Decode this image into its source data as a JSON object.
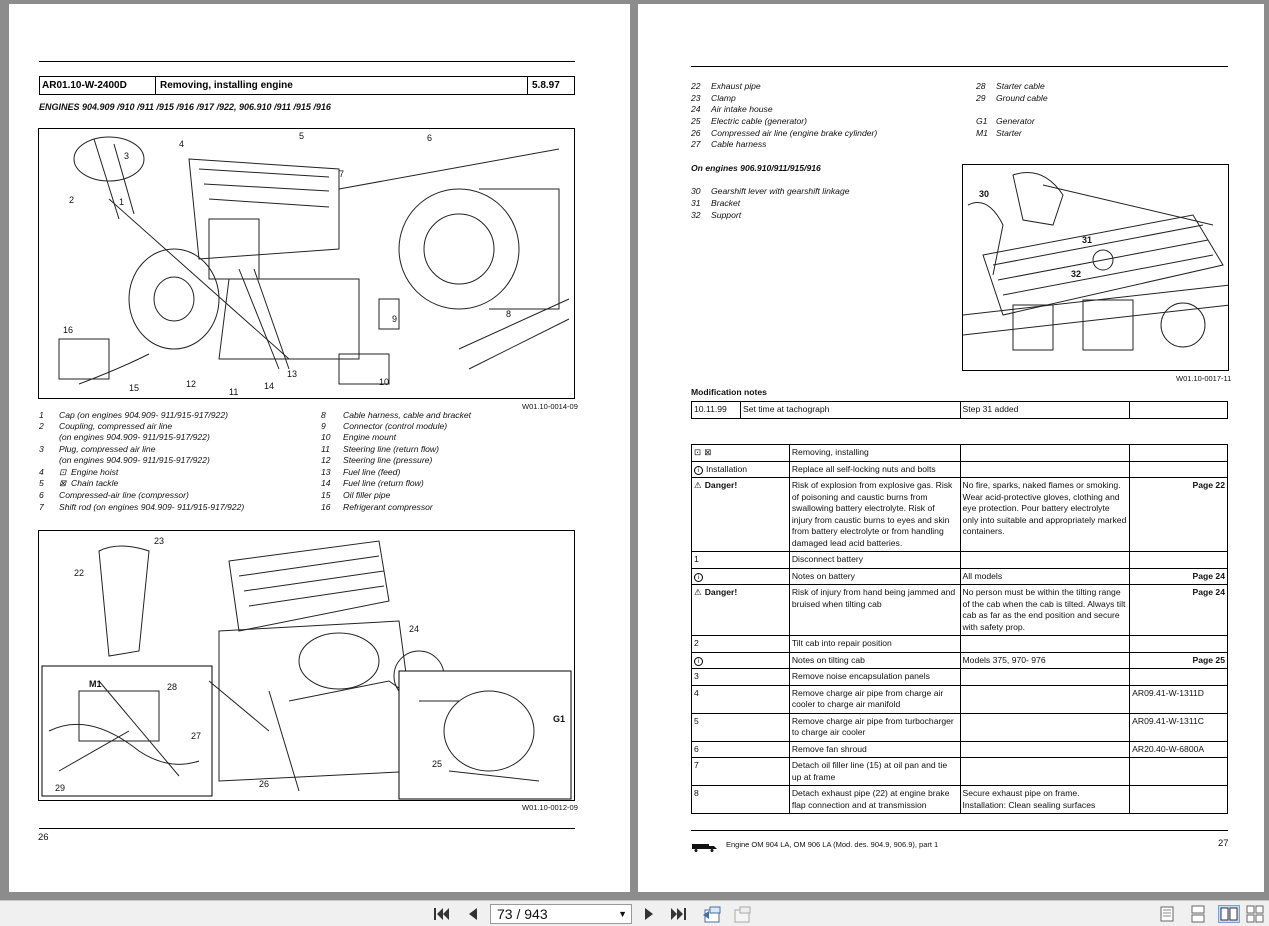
{
  "left_page": {
    "header": {
      "code": "AR01.10-W-2400D",
      "title": "Removing, installing engine",
      "date": "5.8.97"
    },
    "engines_line": "ENGINES   904.909 /910 /911 /915 /916 /917 /922, 906.910 /911 /915 /916",
    "fig1": {
      "caption": "W01.10-0014-09",
      "labels": [
        "1",
        "2",
        "3",
        "4",
        "5",
        "6",
        "7",
        "8",
        "9",
        "10",
        "11",
        "12",
        "13",
        "14",
        "15",
        "16"
      ]
    },
    "legend_left": [
      {
        "n": "1",
        "text": "Cap (on engines 904.909- 911/915-917/922)"
      },
      {
        "n": "2",
        "text": "Coupling, compressed air line"
      },
      {
        "n": "",
        "text": "(on engines 904.909- 911/915-917/922)"
      },
      {
        "n": "3",
        "text": "Plug, compressed air line"
      },
      {
        "n": "",
        "text": "(on engines 904.909- 911/915-917/922)"
      },
      {
        "n": "4",
        "text": "Engine hoist"
      },
      {
        "n": "5",
        "text": "Chain tackle"
      },
      {
        "n": "6",
        "text": "Compressed-air line (compressor)"
      },
      {
        "n": "7",
        "text": "Shift rod (on engines 904.909- 911/915-917/922)"
      }
    ],
    "legend_right": [
      {
        "n": "8",
        "text": "Cable harness, cable and bracket"
      },
      {
        "n": "9",
        "text": "Connector (control module)"
      },
      {
        "n": "10",
        "text": "Engine mount"
      },
      {
        "n": "11",
        "text": "Steering line (return flow)"
      },
      {
        "n": "12",
        "text": "Steering line (pressure)"
      },
      {
        "n": "13",
        "text": "Fuel line (feed)"
      },
      {
        "n": "14",
        "text": "Fuel line (return flow)"
      },
      {
        "n": "15",
        "text": "Oil filler pipe"
      },
      {
        "n": "16",
        "text": "Refrigerant compressor"
      }
    ],
    "fig2": {
      "caption": "W01.10-0012-09",
      "labels": [
        "23",
        "22",
        "24",
        "M1",
        "28",
        "27",
        "G1",
        "25",
        "26",
        "29"
      ]
    },
    "page_number": "26"
  },
  "right_page": {
    "legend_a": [
      {
        "n": "22",
        "text": "Exhaust pipe"
      },
      {
        "n": "23",
        "text": "Clamp"
      },
      {
        "n": "24",
        "text": "Air intake house"
      },
      {
        "n": "25",
        "text": "Electric cable (generator)"
      },
      {
        "n": "26",
        "text": "Compressed air line (engine brake cylinder)"
      },
      {
        "n": "27",
        "text": "Cable harness"
      }
    ],
    "legend_b": [
      {
        "n": "28",
        "text": "Starter cable"
      },
      {
        "n": "29",
        "text": "Ground cable"
      },
      {
        "n": "G1",
        "text": "Generator"
      },
      {
        "n": "M1",
        "text": "Starter"
      }
    ],
    "engines_heading": "On engines 906.910/911/915/916",
    "legend_c": [
      {
        "n": "30",
        "text": "Gearshift lever with gearshift linkage"
      },
      {
        "n": "31",
        "text": "Bracket"
      },
      {
        "n": "32",
        "text": "Support"
      }
    ],
    "fig3": {
      "caption": "W01.10-0017-11",
      "labels": [
        "30",
        "31",
        "32"
      ]
    },
    "mod_heading": "Modification notes",
    "mod_row": {
      "date": "10.11.99",
      "what": "Set time at tachograph",
      "note": "Step 31 added"
    },
    "steps": [
      {
        "a": "",
        "b": "Removing, installing",
        "c": "",
        "d": "",
        "icon": "tools"
      },
      {
        "a": "Installation",
        "b": "Replace all self-locking nuts and bolts",
        "c": "",
        "d": "",
        "icon": "info"
      },
      {
        "a": "Danger!",
        "b": "Risk of explosion from explosive gas. Risk of poisoning and caustic burns from swallowing battery electrolyte. Risk of injury from caustic burns to eyes and skin from battery electrolyte or from handling damaged lead acid batteries.",
        "c": "No fire, sparks, naked flames or smoking. Wear acid-protective gloves, clothing and eye protection. Pour battery electrolyte only into suitable and appropriately marked containers.",
        "d": "Page 22",
        "icon": "warn"
      },
      {
        "a": "1",
        "b": "Disconnect battery",
        "c": "",
        "d": "",
        "icon": ""
      },
      {
        "a": "",
        "b": "Notes on battery",
        "c": "All models",
        "d": "Page 24",
        "icon": "info"
      },
      {
        "a": "Danger!",
        "b": "Risk of injury from hand being jammed and bruised when tilting cab",
        "c": "No person must be within the tilting range of the cab when the cab is tilted. Always tilt cab as far as the end position and secure with safety prop.",
        "d": "Page 24",
        "icon": "warn"
      },
      {
        "a": "2",
        "b": "Tilt cab into repair  position",
        "c": "",
        "d": "",
        "icon": ""
      },
      {
        "a": "",
        "b": "Notes on tilting cab",
        "c": "Models 375, 970- 976",
        "d": "Page 25",
        "icon": "info"
      },
      {
        "a": "3",
        "b": "Remove noise encapsulation panels",
        "c": "",
        "d": "",
        "icon": ""
      },
      {
        "a": "4",
        "b": "Remove charge air pipe from charge air cooler to charge air manifold",
        "c": "",
        "d": "AR09.41-W-1311D",
        "icon": ""
      },
      {
        "a": "5",
        "b": "Remove charge air pipe from turbocharger to charge air cooler",
        "c": "",
        "d": "AR09.41-W-1311C",
        "icon": ""
      },
      {
        "a": "6",
        "b": "Remove fan shroud",
        "c": "",
        "d": "AR20.40-W-6800A",
        "icon": ""
      },
      {
        "a": "7",
        "b": "Detach oil filler line (15) at oil pan and tie up at frame",
        "c": "",
        "d": "",
        "icon": ""
      },
      {
        "a": "8",
        "b": "Detach exhaust pipe (22) at engine brake flap connection and at transmission",
        "c": "Secure exhaust pipe on frame.",
        "c2": "Installation: Clean sealing surfaces",
        "d": "",
        "icon": ""
      }
    ],
    "footer_text": "Engine OM 904 LA, OM 906 LA (Mod. des. 904.9, 906.9), part 1",
    "page_number": "27"
  },
  "toolbar": {
    "page_value": "73 / 943",
    "colors": {
      "bar": "#f0f0f0",
      "active": "#c9d9ef"
    }
  }
}
